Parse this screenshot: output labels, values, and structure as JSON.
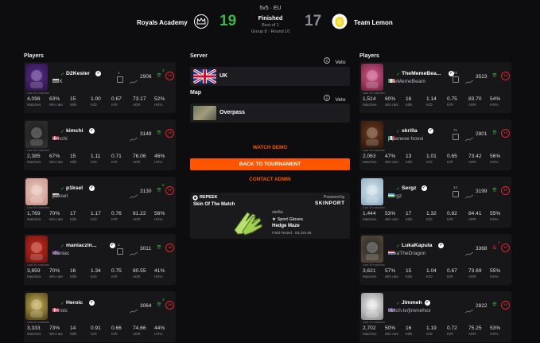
{
  "header": {
    "mode": "5v5 · EU",
    "status": "Finished",
    "best_of": "Best of 1",
    "group_round": "Group 8 · Round 10",
    "team_left": {
      "name": "Royals Academy",
      "score": "19",
      "score_color": "#3fb54b"
    },
    "team_right": {
      "name": "Team Lemon",
      "score": "17",
      "score_color": "#8a8a90"
    }
  },
  "sections": {
    "players_left": "Players",
    "players_right": "Players",
    "server": "Server",
    "map": "Map"
  },
  "server": {
    "name": "UK",
    "veto": "Veto"
  },
  "map": {
    "name": "Overpass",
    "veto": "Veto"
  },
  "actions": {
    "watch_demo": "WATCH DEMO",
    "back": "BACK TO TOURNAMENT",
    "contact": "CONTACT ADMIN"
  },
  "ad": {
    "sponsor": "REPEEK",
    "title": "Skin Of The Match",
    "powered_by": "Powered by",
    "brand": "SKINPORT",
    "source": "skrilla",
    "item_type": "★ Sport Gloves",
    "item_name": "Hedge Maze",
    "item_price": "Field-Tested · £8,220.96"
  },
  "stat_labels": {
    "matches": "Matches",
    "winrate": "Win rate",
    "kills": "Kills",
    "kd": "K/D",
    "kr": "K/R",
    "adr": "ADR",
    "hs": "HS%",
    "last30": "Last 30 matches"
  },
  "players_left": [
    {
      "name": "D2Kester",
      "nick": "D2K",
      "elo": "2906",
      "trend": "2",
      "trend_dir": "up",
      "level": "10",
      "matches": "4,098",
      "winrate": "63%",
      "kills": "15",
      "kd": "1.00",
      "kr": "0.67",
      "adr": "73.17",
      "hs": "52%",
      "flag": "other",
      "extra": "1"
    },
    {
      "name": "kimchi",
      "nick": "kimchi",
      "elo": "3149",
      "trend": "",
      "trend_dir": "up",
      "level": "10",
      "matches": "2,385",
      "winrate": "67%",
      "kills": "15",
      "kd": "1.11",
      "kr": "0.71",
      "adr": "76.06",
      "hs": "46%",
      "flag": "dk",
      "extra": ""
    },
    {
      "name": "p1ksel",
      "nick": "p1ksel",
      "elo": "3130",
      "trend": "5",
      "trend_dir": "up",
      "level": "10",
      "matches": "1,769",
      "winrate": "70%",
      "kills": "17",
      "kd": "1.17",
      "kr": "0.76",
      "adr": "81.22",
      "hs": "56%",
      "flag": "other",
      "extra": ""
    },
    {
      "name": "maniaczin...",
      "nick": "maniac",
      "elo": "3011",
      "trend": "",
      "trend_dir": "up",
      "level": "10",
      "matches": "3,859",
      "winrate": "70%",
      "kills": "16",
      "kd": "1.34",
      "kr": "0.75",
      "adr": "80.55",
      "hs": "41%",
      "flag": "gb",
      "extra": "1"
    },
    {
      "name": "Heroic",
      "nick": "Heroic",
      "elo": "3064",
      "trend": "2",
      "trend_dir": "up",
      "level": "10",
      "matches": "3,333",
      "winrate": "73%",
      "kills": "14",
      "kd": "0.91",
      "kr": "0.66",
      "adr": "74.66",
      "hs": "44%",
      "flag": "dk",
      "extra": ""
    }
  ],
  "players_right": [
    {
      "name": "TheMemeBea...",
      "nick": "TheMemeBeam",
      "elo": "3523",
      "trend": "",
      "trend_dir": "up",
      "level": "10",
      "matches": "1,514",
      "winrate": "60%",
      "kills": "16",
      "kd": "1.14",
      "kr": "0.75",
      "adr": "83.70",
      "hs": "54%",
      "flag": "ie",
      "extra": "33"
    },
    {
      "name": "skrilla",
      "nick": "japanese hooxi",
      "elo": "2801",
      "trend": "",
      "trend_dir": "up",
      "level": "10",
      "matches": "2,063",
      "winrate": "47%",
      "kills": "13",
      "kd": "1.01",
      "kr": "0.65",
      "adr": "73.42",
      "hs": "56%",
      "flag": "it",
      "extra": "71"
    },
    {
      "name": "Sergz",
      "nick": "Sergz",
      "elo": "3199",
      "trend": "",
      "trend_dir": "up",
      "level": "10",
      "matches": "1,444",
      "winrate": "53%",
      "kills": "17",
      "kd": "1.32",
      "kr": "0.82",
      "adr": "84.41",
      "hs": "55%",
      "flag": "uz",
      "extra": "44"
    },
    {
      "name": "LukaKapula",
      "nick": "LukaTheDragon",
      "elo": "3368",
      "trend": "2",
      "trend_dir": "down",
      "level": "10",
      "matches": "3,621",
      "winrate": "57%",
      "kills": "15",
      "kd": "1.04",
      "kr": "0.67",
      "adr": "73.69",
      "hs": "55%",
      "flag": "nl",
      "extra": ""
    },
    {
      "name": "Jimmeh",
      "nick": "twitch.tv/jimmehxx",
      "elo": "2822",
      "trend": "",
      "trend_dir": "up",
      "level": "10",
      "matches": "2,702",
      "winrate": "50%",
      "kills": "16",
      "kd": "1.19",
      "kr": "0.72",
      "adr": "75.25",
      "hs": "53%",
      "flag": "gb",
      "extra": ""
    }
  ]
}
